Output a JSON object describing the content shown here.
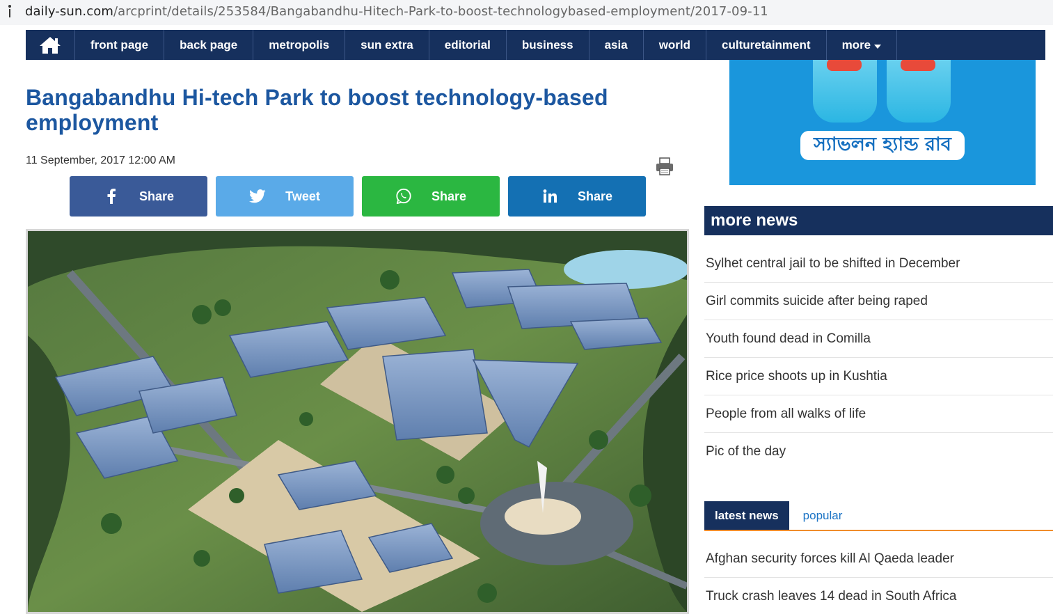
{
  "browser": {
    "url_domain": "daily-sun.com",
    "url_path": "/arcprint/details/253584/Bangabandhu-Hitech-Park-to-boost-technologybased-employment/2017-09-11"
  },
  "nav": {
    "home_icon": "home-icon",
    "items": [
      "front page",
      "back page",
      "metropolis",
      "sun extra",
      "editorial",
      "business",
      "asia",
      "world",
      "culturetainment",
      "more"
    ]
  },
  "article": {
    "title": "Bangabandhu Hi-tech Park to boost technology-based employment",
    "date": "11 September, 2017 12:00 AM",
    "print_icon": "printer-icon"
  },
  "share_buttons": [
    {
      "label": "Share",
      "icon": "facebook-icon",
      "color": "#3a5a98"
    },
    {
      "label": "Tweet",
      "icon": "twitter-icon",
      "color": "#5aaae8"
    },
    {
      "label": "Share",
      "icon": "whatsapp-icon",
      "color": "#2bb741"
    },
    {
      "label": "Share",
      "icon": "linkedin-icon",
      "color": "#1470b3"
    }
  ],
  "ad": {
    "slogan": "স্যাভলন হ্যান্ড রাব"
  },
  "sidebar": {
    "more_news_title": "more news",
    "more_news": [
      "Sylhet central jail to be shifted in December",
      "Girl commits suicide after being raped",
      "Youth found dead in Comilla",
      "Rice price shoots up in Kushtia",
      "People from all walks of life",
      "Pic of the day"
    ],
    "tabs": [
      "latest news",
      "popular"
    ],
    "latest_news": [
      "Afghan security forces kill Al Qaeda leader",
      "Truck crash leaves 14 dead in South Africa"
    ]
  },
  "colors": {
    "nav_bg": "#16305d",
    "headline": "#1c57a0",
    "tab_accent": "#f08c2a"
  }
}
